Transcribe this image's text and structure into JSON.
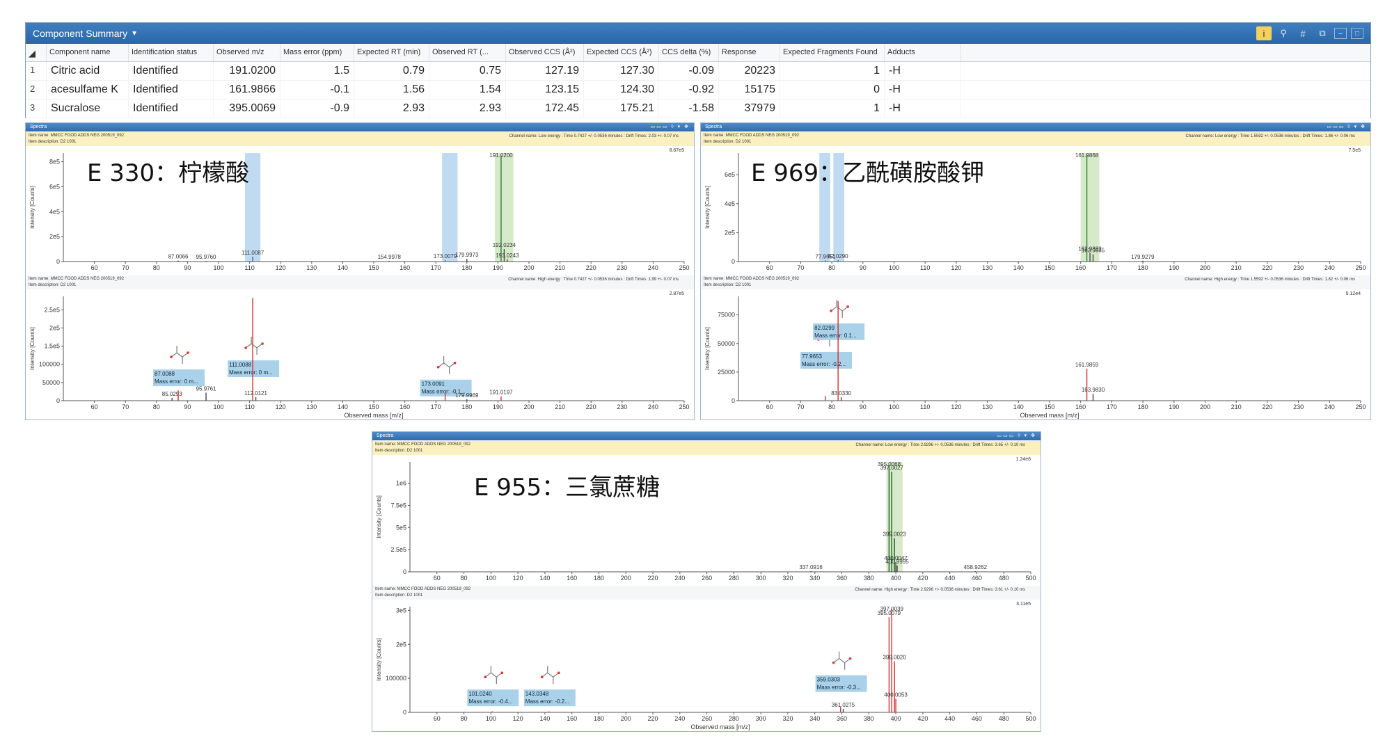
{
  "summary": {
    "title": "Component Summary",
    "columns": [
      "Component name",
      "Identification status",
      "Observed m/z",
      "Mass error (ppm)",
      "Expected RT (min)",
      "Observed RT (...",
      "Observed CCS (Å²)",
      "Expected CCS (Å²)",
      "CCS delta (%)",
      "Response",
      "Expected Fragments Found",
      "Adducts"
    ],
    "rows": [
      {
        "n": "1",
        "cells": [
          "Citric acid",
          "Identified",
          "191.0200",
          "1.5",
          "0.79",
          "0.75",
          "127.19",
          "127.30",
          "-0.09",
          "20223",
          "1",
          "-H"
        ]
      },
      {
        "n": "2",
        "cells": [
          "acesulfame K",
          "Identified",
          "161.9866",
          "-0.1",
          "1.56",
          "1.54",
          "123.15",
          "124.30",
          "-0.92",
          "15175",
          "0",
          "-H"
        ]
      },
      {
        "n": "3",
        "cells": [
          "Sucralose",
          "Identified",
          "395.0069",
          "-0.9",
          "2.93",
          "2.93",
          "172.45",
          "175.21",
          "-1.58",
          "37979",
          "1",
          "-H"
        ]
      }
    ]
  },
  "panels": [
    {
      "id": "p1",
      "title": "Spectra",
      "label": "E 330：柠檬酸",
      "low": {
        "item_name": "Item name: MMCC FOOD ADDS NEG 200519_092",
        "item_desc": "Item description: D2 1001",
        "channel": "Channel name: Low energy : Time 0.7427 +/- 0.0536 minutes : Drift Times: 2.03 +/- 0.07 ms",
        "scale": "8.67e5",
        "ylabel": "Intensity [Counts]",
        "x_range": [
          50,
          250
        ],
        "x_ticks": [
          60,
          70,
          80,
          90,
          100,
          110,
          120,
          130,
          140,
          150,
          160,
          170,
          180,
          190,
          200,
          210,
          220,
          230,
          240,
          250
        ],
        "y_max": 870000,
        "y_ticks": [
          [
            0,
            "0"
          ],
          [
            200000,
            "2e5"
          ],
          [
            400000,
            "4e5"
          ],
          [
            600000,
            "6e5"
          ],
          [
            800000,
            "8e5"
          ]
        ],
        "bands": [
          [
            108.5,
            113.5,
            "#b5d5ee"
          ],
          [
            172,
            177,
            "#b5d5ee"
          ],
          [
            189,
            195,
            "#cfe6c0"
          ]
        ],
        "peaks": [
          {
            "x": 87.0066,
            "y": 8000,
            "color": "#444",
            "label": "87.0066"
          },
          {
            "x": 95.976,
            "y": 6000,
            "color": "#444",
            "label": "95.9760"
          },
          {
            "x": 111.0087,
            "y": 40000,
            "color": "#2b6cb0",
            "label": "111.0087"
          },
          {
            "x": 154.9978,
            "y": 6000,
            "color": "#444",
            "label": "154.9978"
          },
          {
            "x": 173.0079,
            "y": 12000,
            "color": "#2b6cb0",
            "label": "173.0079"
          },
          {
            "x": 179.9973,
            "y": 22000,
            "color": "#444",
            "label": "179.9973"
          },
          {
            "x": 191.02,
            "y": 850000,
            "color": "#2e7d32",
            "label": "191.0200"
          },
          {
            "x": 192.0234,
            "y": 100000,
            "color": "#444",
            "label": "192.0234"
          },
          {
            "x": 193.0243,
            "y": 18000,
            "color": "#444",
            "label": "193.0243"
          }
        ]
      },
      "high": {
        "item_name": "Item name: MMCC FOOD ADDS NEG 200519_092",
        "item_desc": "Item description: D2 1001",
        "channel": "Channel name: High energy : Time 0.7427 +/- 0.0536 minutes : Drift Times: 1.99 +/- 0.07 ms",
        "scale": "2.87e5",
        "ylabel": "Intensity [Counts]",
        "xlabel": "Observed mass [m/z]",
        "x_range": [
          50,
          250
        ],
        "x_ticks": [
          60,
          70,
          80,
          90,
          100,
          110,
          120,
          130,
          140,
          150,
          160,
          170,
          180,
          190,
          200,
          210,
          220,
          230,
          240,
          250
        ],
        "y_max": 287000,
        "y_ticks": [
          [
            0,
            "0"
          ],
          [
            50000,
            "50000"
          ],
          [
            100000,
            "100000"
          ],
          [
            150000,
            "1.5e5"
          ],
          [
            200000,
            "2e5"
          ],
          [
            250000,
            "2.5e5"
          ]
        ],
        "peaks": [
          {
            "x": 85.0293,
            "y": 8000,
            "color": "#444",
            "label": "85.0293"
          },
          {
            "x": 87.0088,
            "y": 28000,
            "color": "#d32f2f",
            "label": ""
          },
          {
            "x": 95.9761,
            "y": 22000,
            "color": "#444",
            "label": "95.9761"
          },
          {
            "x": 111.0088,
            "y": 283000,
            "color": "#d32f2f",
            "label": ""
          },
          {
            "x": 112.0121,
            "y": 10000,
            "color": "#444",
            "label": "112.0121"
          },
          {
            "x": 173.0091,
            "y": 22000,
            "color": "#d32f2f",
            "label": ""
          },
          {
            "x": 179.9969,
            "y": 4000,
            "color": "#444",
            "label": "179.9969"
          },
          {
            "x": 191.0197,
            "y": 12000,
            "color": "#d32f2f",
            "label": "191.0197"
          }
        ],
        "frag_boxes": [
          {
            "x": 87.0088,
            "y": 40000,
            "l1": "87.0088",
            "l2": "Mass error: 0 m..."
          },
          {
            "x": 111.0088,
            "y": 65000,
            "l1": "111.0088",
            "l2": "Mass error: 0 m..."
          },
          {
            "x": 173.0091,
            "y": 12000,
            "l1": "173.0091",
            "l2": "Mass error: -0.1..."
          }
        ]
      }
    },
    {
      "id": "p2",
      "title": "Spectra",
      "label": "E 969：乙酰磺胺酸钾",
      "low": {
        "item_name": "Item name: MMCC FOOD ADDS NEG 200519_092",
        "item_desc": "Item description: D2 1001",
        "channel": "Channel name: Low energy : Time 1.5592 +/- 0.0536 minutes : Drift Times: 1.86 +/- 0.06 ms",
        "scale": "7.5e5",
        "ylabel": "Intensity [Counts]",
        "x_range": [
          50,
          250
        ],
        "x_ticks": [
          60,
          70,
          80,
          90,
          100,
          110,
          120,
          130,
          140,
          150,
          160,
          170,
          180,
          190,
          200,
          210,
          220,
          230,
          240,
          250
        ],
        "y_max": 750000,
        "y_ticks": [
          [
            0,
            "0"
          ],
          [
            200000,
            "2e5"
          ],
          [
            400000,
            "4e5"
          ],
          [
            600000,
            "6e5"
          ]
        ],
        "bands": [
          [
            76,
            79.5,
            "#b5d5ee"
          ],
          [
            80.5,
            84,
            "#b5d5ee"
          ],
          [
            160,
            166,
            "#cfe6c0"
          ]
        ],
        "peaks": [
          {
            "x": 77.9651,
            "y": 8000,
            "color": "#2b6cb0",
            "label": "77.9651"
          },
          {
            "x": 82.029,
            "y": 10000,
            "color": "#2b6cb0",
            "label": "82.0290"
          },
          {
            "x": 161.9868,
            "y": 740000,
            "color": "#2e7d32",
            "label": "161.9868"
          },
          {
            "x": 162.9882,
            "y": 60000,
            "color": "#444",
            "label": "162.9882"
          },
          {
            "x": 163.9835,
            "y": 50000,
            "color": "#444",
            "label": "163.9835"
          },
          {
            "x": 179.9279,
            "y": 6000,
            "color": "#444",
            "label": "179.9279"
          }
        ]
      },
      "high": {
        "item_name": "Item name: MMCC FOOD ADDS NEG 200519_092",
        "item_desc": "Item description: D2 1001",
        "channel": "Channel name: High energy : Time 1.5592 +/- 0.0536 minutes : Drift Times: 1.82 +/- 0.06 ms",
        "scale": "9.12e4",
        "ylabel": "Intensity [Counts]",
        "xlabel": "Observed mass [m/z]",
        "x_range": [
          50,
          250
        ],
        "x_ticks": [
          60,
          70,
          80,
          90,
          100,
          110,
          120,
          130,
          140,
          150,
          160,
          170,
          180,
          190,
          200,
          210,
          220,
          230,
          240,
          250
        ],
        "y_max": 91200,
        "y_ticks": [
          [
            0,
            "0"
          ],
          [
            25000,
            "25000"
          ],
          [
            50000,
            "50000"
          ],
          [
            75000,
            "75000"
          ]
        ],
        "peaks": [
          {
            "x": 77.9653,
            "y": 4000,
            "color": "#d32f2f",
            "label": ""
          },
          {
            "x": 82.0299,
            "y": 87000,
            "color": "#d32f2f",
            "label": ""
          },
          {
            "x": 83.033,
            "y": 3000,
            "color": "#444",
            "label": "83.0330"
          },
          {
            "x": 161.9859,
            "y": 28000,
            "color": "#d32f2f",
            "label": "161.9859"
          },
          {
            "x": 163.983,
            "y": 6000,
            "color": "#444",
            "label": "163.9830"
          }
        ],
        "frag_boxes": [
          {
            "x": 77.9653,
            "y": 28000,
            "l1": "77.9653",
            "l2": "Mass error: -0.2..."
          },
          {
            "x": 82.0299,
            "y": 53000,
            "l1": "82.0299",
            "l2": "Mass error: 0.1..."
          }
        ]
      }
    },
    {
      "id": "p3",
      "title": "Spectra",
      "label": "E 955：三氯蔗糖",
      "low": {
        "item_name": "Item name: MMCC FOOD ADDS NEG 200519_092",
        "item_desc": "Item description: D2 1001",
        "channel": "Channel name: Low energy : Time 2.9296 +/- 0.0536 minutes : Drift Times: 3.65 +/- 0.10 ms",
        "scale": "1.24e6",
        "ylabel": "Intensity [Counts]",
        "x_range": [
          40,
          500
        ],
        "x_ticks": [
          60,
          80,
          100,
          120,
          140,
          160,
          180,
          200,
          220,
          240,
          260,
          280,
          300,
          320,
          340,
          360,
          380,
          400,
          420,
          440,
          460,
          480,
          500
        ],
        "y_max": 1240000,
        "y_ticks": [
          [
            0,
            "0"
          ],
          [
            250000,
            "2.5e5"
          ],
          [
            500000,
            "5e5"
          ],
          [
            750000,
            "7.5e5"
          ],
          [
            1000000,
            "1e6"
          ]
        ],
        "bands": [
          [
            393,
            405,
            "#cfe6c0"
          ]
        ],
        "peaks": [
          {
            "x": 337.0916,
            "y": 8000,
            "color": "#444",
            "label": "337.0916"
          },
          {
            "x": 395.0068,
            "y": 1200000,
            "color": "#1b5e20",
            "label": "395.0068"
          },
          {
            "x": 397.0027,
            "y": 1130000,
            "color": "#1b5e20",
            "label": "397.0027"
          },
          {
            "x": 399.0023,
            "y": 380000,
            "color": "#1b5e20",
            "label": "399.0023"
          },
          {
            "x": 400.0047,
            "y": 110000,
            "color": "#444",
            "label": "400.0047"
          },
          {
            "x": 400.9995,
            "y": 70000,
            "color": "#444",
            "label": "400.9995"
          },
          {
            "x": 458.9262,
            "y": 8000,
            "color": "#444",
            "label": "458.9262"
          }
        ]
      },
      "high": {
        "item_name": "Item name: MMCC FOOD ADDS NEG 200519_092",
        "item_desc": "Item description: D2 1001",
        "channel": "Channel name: High energy : Time 2.9296 +/- 0.0536 minutes : Drift Times: 3.61 +/- 0.10 ms",
        "scale": "3.11e5",
        "ylabel": "Intensity [Counts]",
        "xlabel": "Observed mass [m/z]",
        "x_range": [
          40,
          500
        ],
        "x_ticks": [
          60,
          80,
          100,
          120,
          140,
          160,
          180,
          200,
          220,
          240,
          260,
          280,
          300,
          320,
          340,
          360,
          380,
          400,
          420,
          440,
          460,
          480,
          500
        ],
        "y_max": 311000,
        "y_ticks": [
          [
            0,
            "0"
          ],
          [
            100000,
            "100000"
          ],
          [
            200000,
            "2e5"
          ],
          [
            300000,
            "3e5"
          ]
        ],
        "peaks": [
          {
            "x": 101.024,
            "y": 3000,
            "color": "#d32f2f",
            "label": ""
          },
          {
            "x": 143.0348,
            "y": 3000,
            "color": "#d32f2f",
            "label": ""
          },
          {
            "x": 359.0303,
            "y": 16000,
            "color": "#d32f2f",
            "label": ""
          },
          {
            "x": 361.0275,
            "y": 10000,
            "color": "#444",
            "label": "361.0275"
          },
          {
            "x": 395.0079,
            "y": 280000,
            "color": "#d32f2f",
            "label": "395.0079"
          },
          {
            "x": 397.0039,
            "y": 305000,
            "color": "#d32f2f",
            "label": "397.0039"
          },
          {
            "x": 399.002,
            "y": 150000,
            "color": "#d32f2f",
            "label": "399.0020"
          },
          {
            "x": 400.0053,
            "y": 40000,
            "color": "#d32f2f",
            "label": "400.0053"
          }
        ],
        "frag_boxes": [
          {
            "x": 101.024,
            "y": 18000,
            "l1": "101.0240",
            "l2": "Mass error: -0.4..."
          },
          {
            "x": 143.0348,
            "y": 18000,
            "l1": "143.0348",
            "l2": "Mass error: -0.2..."
          },
          {
            "x": 359.0303,
            "y": 60000,
            "l1": "359.0303",
            "l2": "Mass error: -0.3..."
          }
        ]
      }
    }
  ]
}
